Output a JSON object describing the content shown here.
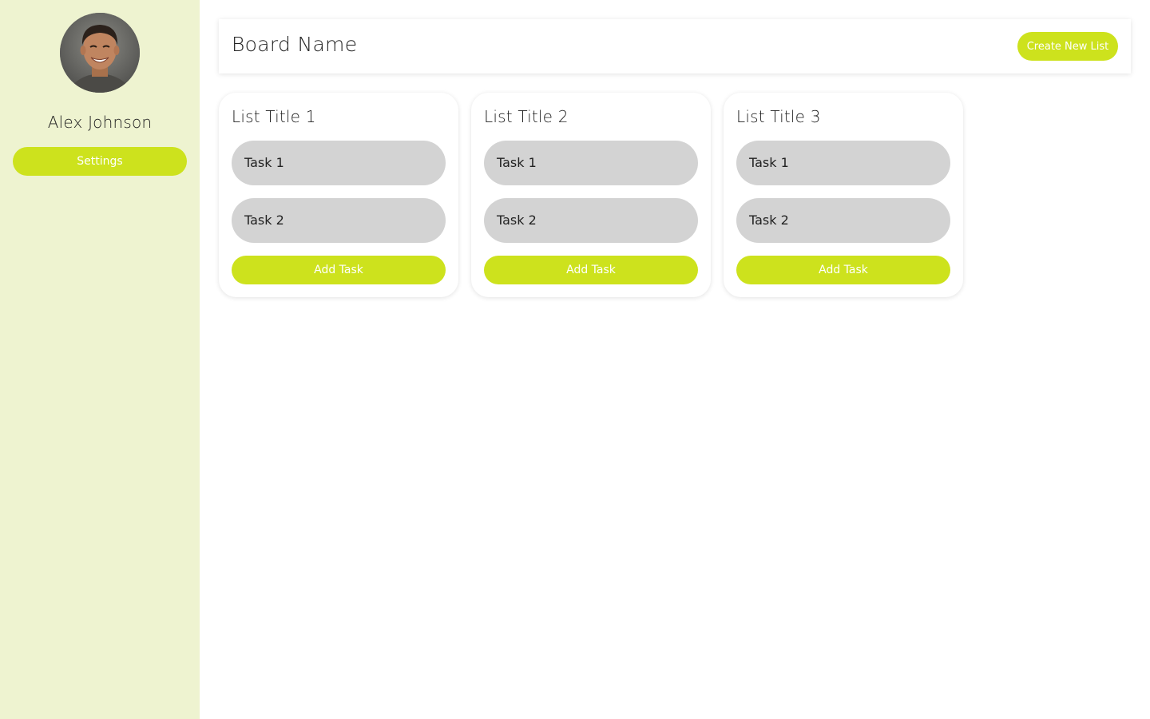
{
  "sidebar": {
    "avatar_icon": "user-avatar-photo",
    "user_name": "Alex Johnson",
    "settings_label": "Settings"
  },
  "header": {
    "board_name": "Board Name",
    "create_list_label": "Create New List"
  },
  "lists": [
    {
      "title": "List Title 1",
      "tasks": [
        "Task 1",
        "Task 2"
      ],
      "add_task_label": "Add Task"
    },
    {
      "title": "List Title 2",
      "tasks": [
        "Task 1",
        "Task 2"
      ],
      "add_task_label": "Add Task"
    },
    {
      "title": "List Title 3",
      "tasks": [
        "Task 1",
        "Task 2"
      ],
      "add_task_label": "Add Task"
    }
  ],
  "colors": {
    "accent": "#cde21d",
    "sidebar_bg": "#eef3d0",
    "task_bg": "#d3d3d3",
    "background": "#ffffff"
  }
}
